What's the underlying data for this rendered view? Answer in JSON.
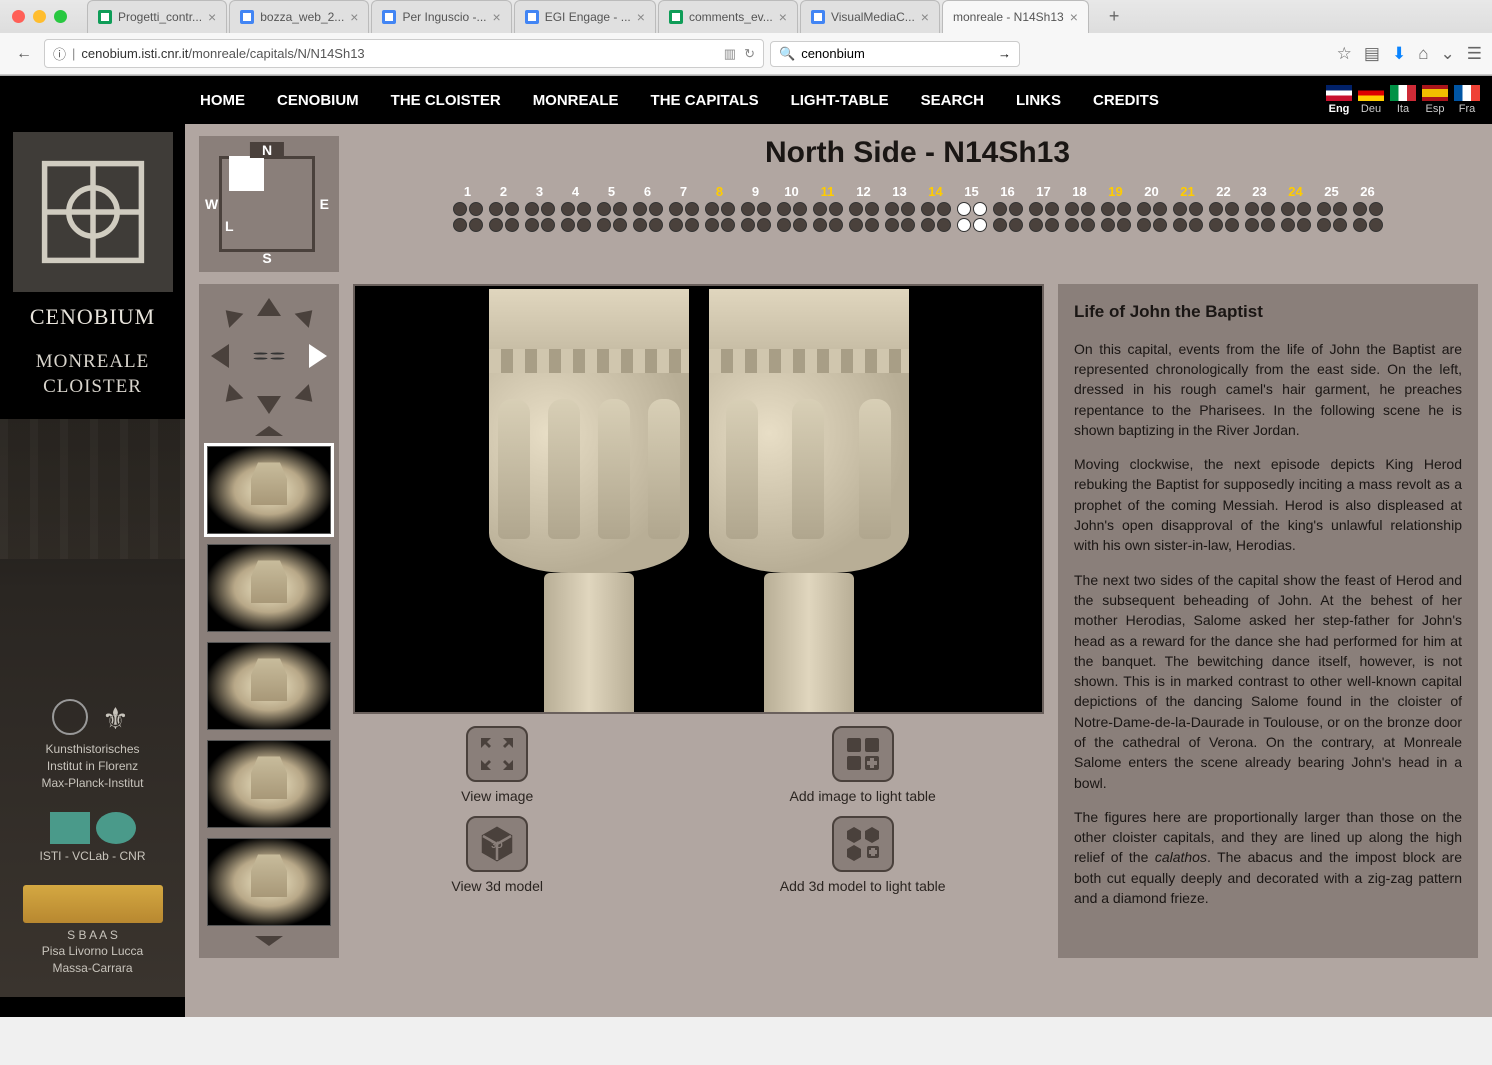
{
  "browser": {
    "url_host": "cenobium.isti.cnr.it",
    "url_path": "/monreale/capitals/N/N14Sh13",
    "search_value": "cenonbium",
    "tabs": [
      {
        "label": "Progetti_contr...",
        "icon": "sheets"
      },
      {
        "label": "bozza_web_2...",
        "icon": "docs"
      },
      {
        "label": "Per Inguscio -...",
        "icon": "docs"
      },
      {
        "label": "EGI Engage - ...",
        "icon": "docs"
      },
      {
        "label": "comments_ev...",
        "icon": "sheets"
      },
      {
        "label": "VisualMediaC...",
        "icon": "docs"
      },
      {
        "label": "monreale - N14Sh13",
        "icon": "",
        "active": true
      }
    ]
  },
  "nav": {
    "items": [
      "HOME",
      "CENOBIUM",
      "THE CLOISTER",
      "MONREALE",
      "THE CAPITALS",
      "LIGHT-TABLE",
      "SEARCH",
      "LINKS",
      "CREDITS"
    ],
    "langs": [
      {
        "code": "Eng",
        "flag": "uk",
        "active": true
      },
      {
        "code": "Deu",
        "flag": "de"
      },
      {
        "code": "Ita",
        "flag": "it"
      },
      {
        "code": "Esp",
        "flag": "es"
      },
      {
        "code": "Fra",
        "flag": "fr"
      }
    ]
  },
  "sidebar": {
    "logo_title": "CENOBIUM",
    "logo_sub": "MONREALE\nCLOISTER",
    "credit1": "Kunsthistorisches\nInstitut in Florenz\nMax-Planck-Institut",
    "credit2": "ISTI - VCLab - CNR",
    "credit3": "S B A A S\nPisa Livorno Lucca\nMassa-Carrara"
  },
  "compass": {
    "N": "N",
    "E": "E",
    "S": "S",
    "W": "W",
    "L": "L"
  },
  "page": {
    "title": "North Side - N14Sh13",
    "numbers": [
      {
        "n": "1"
      },
      {
        "n": "2"
      },
      {
        "n": "3"
      },
      {
        "n": "4"
      },
      {
        "n": "5"
      },
      {
        "n": "6"
      },
      {
        "n": "7"
      },
      {
        "n": "8",
        "hl": true
      },
      {
        "n": "9"
      },
      {
        "n": "10"
      },
      {
        "n": "11",
        "hl": true
      },
      {
        "n": "12"
      },
      {
        "n": "13"
      },
      {
        "n": "14",
        "hl": true
      },
      {
        "n": "15",
        "lit": true
      },
      {
        "n": "16"
      },
      {
        "n": "17"
      },
      {
        "n": "18"
      },
      {
        "n": "19",
        "hl": true
      },
      {
        "n": "20"
      },
      {
        "n": "21",
        "hl": true
      },
      {
        "n": "22"
      },
      {
        "n": "23"
      },
      {
        "n": "24",
        "hl": true
      },
      {
        "n": "25"
      },
      {
        "n": "26"
      }
    ]
  },
  "buttons": {
    "view_image": "View image",
    "add_image": "Add image to light table",
    "view_3d": "View 3d model",
    "add_3d": "Add 3d model to light table"
  },
  "desc": {
    "title": "Life of John the Baptist",
    "p1": "On this capital, events from the life of John the Baptist are represented chronologically from the east side. On the left, dressed in his rough camel's hair garment, he preaches repentance to the Pharisees. In the following scene he is shown baptizing in the River Jordan.",
    "p2": "Moving clockwise, the next episode depicts King Herod rebuking the Baptist for supposedly inciting a mass revolt as a prophet of the coming Messiah. Herod is also displeased at John's open disapproval of the king's unlawful relationship with his own sister-in-law, Herodias.",
    "p3": "The next two sides of the capital show the feast of Herod and the subsequent beheading of John. At the behest of her mother Herodias, Salome asked her step-father for John's head as a reward for the dance she had performed for him at the banquet. The bewitching dance itself, however, is not shown. This is in marked contrast to other well-known capital depictions of the dancing Salome found in the cloister of Notre-Dame-de-la-Daurade in Toulouse, or on the bronze door of the cathedral of Verona. On the contrary, at Monreale Salome enters the scene already bearing John's head in a bowl.",
    "p4_a": "The figures here are proportionally larger than those on the other cloister capitals, and they are lined up along the high relief of the ",
    "p4_em": "calathos",
    "p4_b": ". The abacus and the impost block are both cut equally deeply and decorated with a zig-zag pattern and a diamond frieze."
  }
}
